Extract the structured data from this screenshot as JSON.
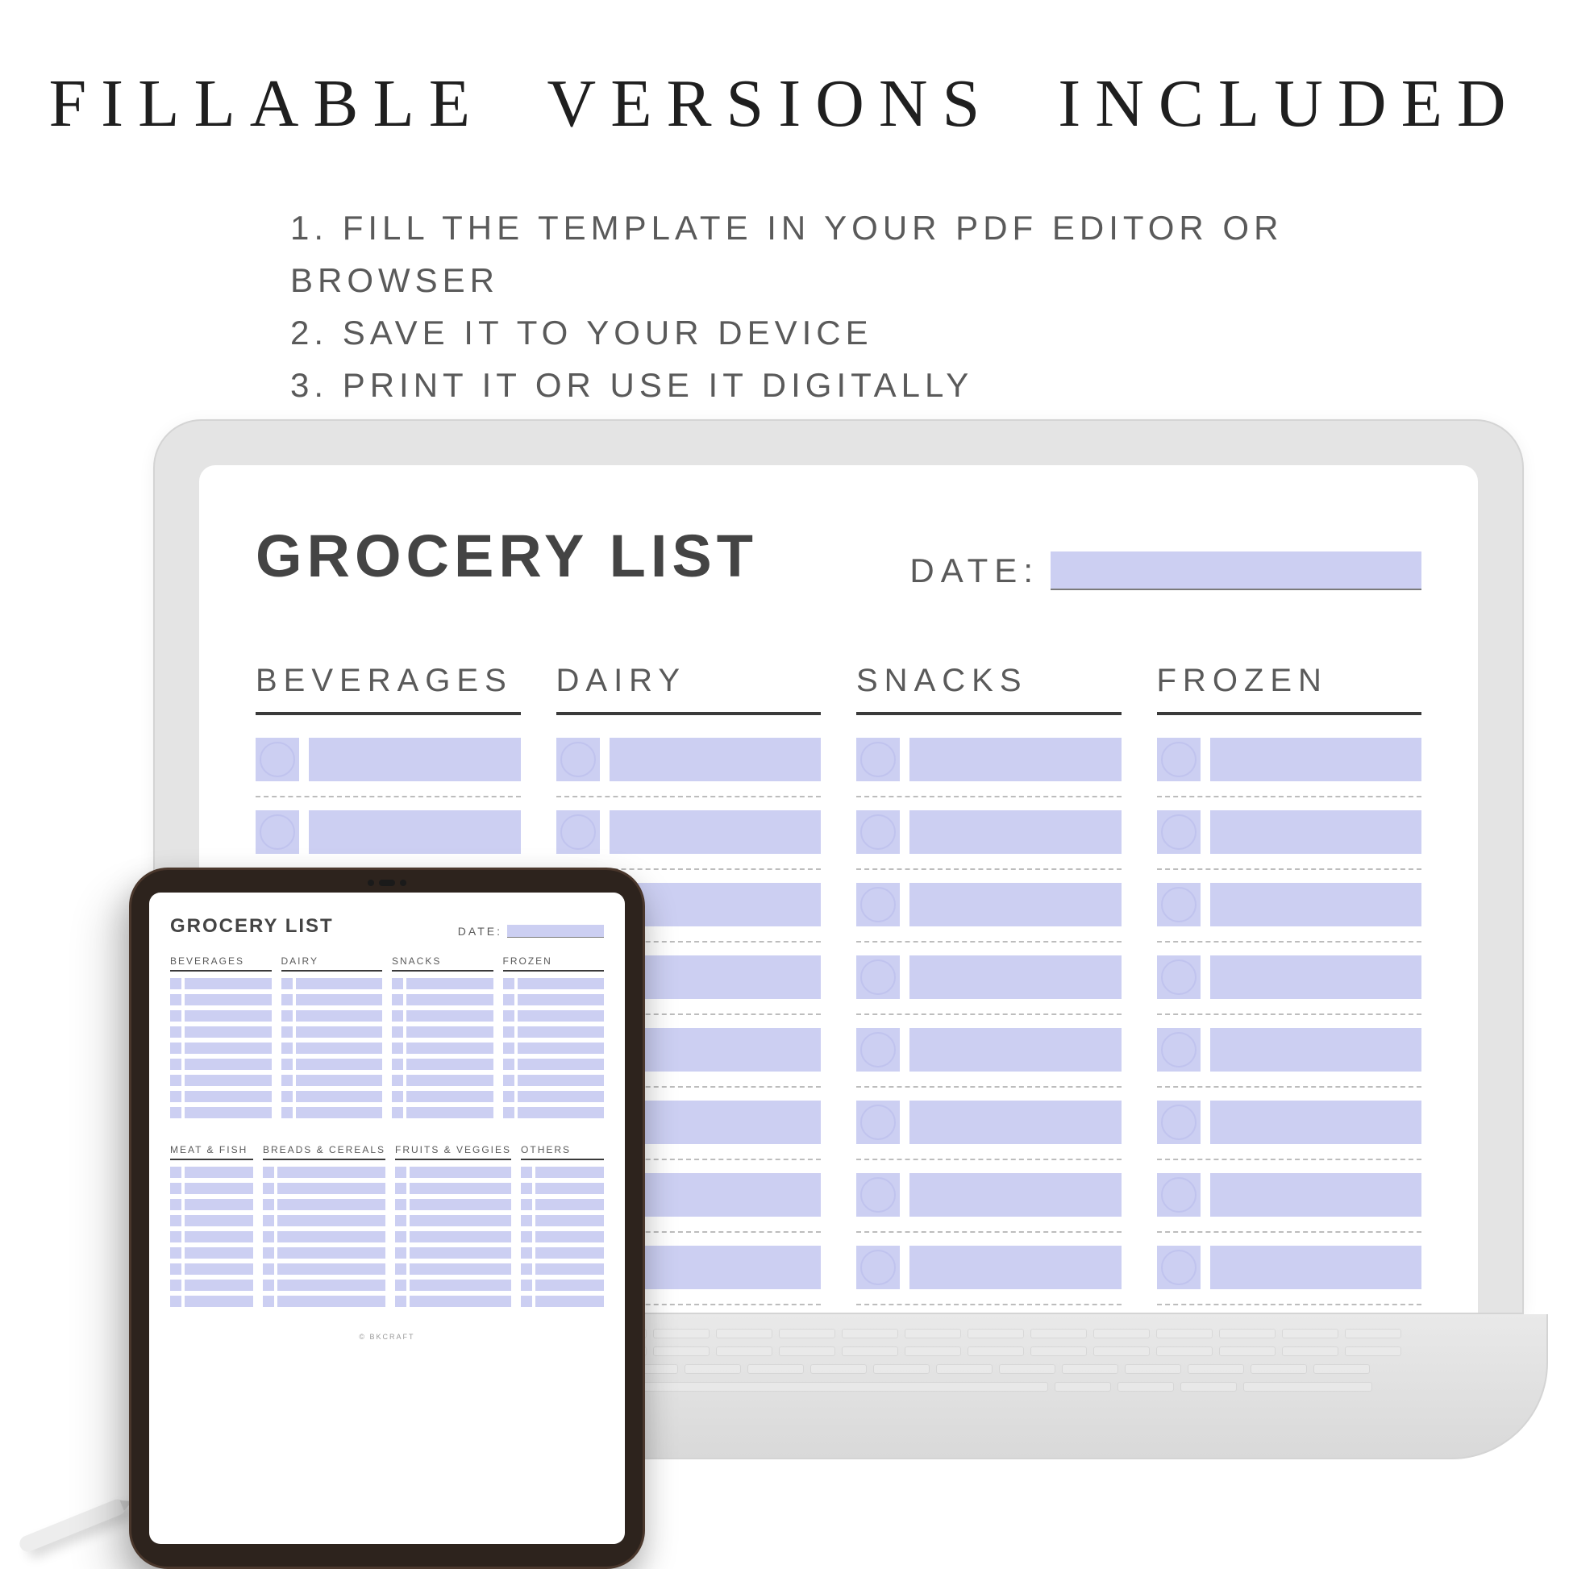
{
  "headline": "FILLABLE VERSIONS INCLUDED",
  "steps": [
    "1. FILL THE TEMPLATE IN YOUR PDF EDITOR OR BROWSER",
    "2. SAVE IT TO YOUR DEVICE",
    "3. PRINT IT OR USE IT DIGITALLY"
  ],
  "doc": {
    "title": "GROCERY LIST",
    "date_label": "DATE:",
    "date_value": "",
    "section_groups": [
      {
        "columns": [
          "BEVERAGES",
          "DAIRY",
          "SNACKS",
          "FROZEN"
        ]
      },
      {
        "columns": [
          "MEAT & FISH",
          "BREADS & CEREALS",
          "FRUITS & VEGGIES",
          "OTHERS"
        ]
      }
    ],
    "rows_per_column_tablet": 9,
    "rows_visible_laptop": 9
  },
  "footer_credit": "© BKCRAFT",
  "colors": {
    "fill": "#cccff2",
    "ink": "#333333"
  }
}
